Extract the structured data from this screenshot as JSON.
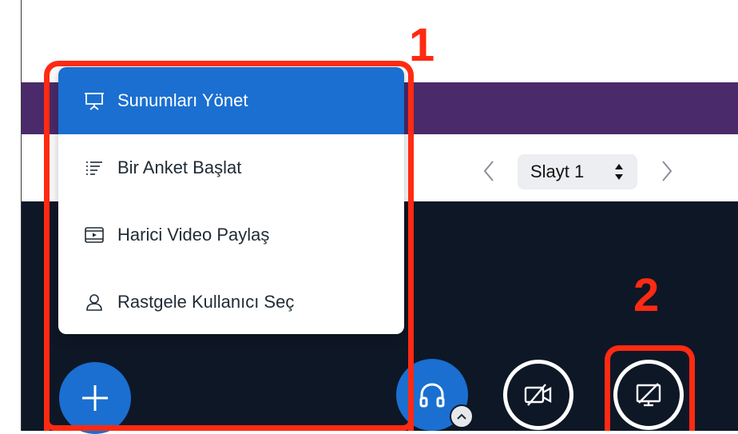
{
  "menu": {
    "items": [
      {
        "label": "Sunumları Yönet",
        "icon": "presentation-icon",
        "active": true
      },
      {
        "label": "Bir Anket Başlat",
        "icon": "poll-list-icon",
        "active": false
      },
      {
        "label": "Harici Video Paylaş",
        "icon": "video-film-icon",
        "active": false
      },
      {
        "label": "Rastgele Kullanıcı Seç",
        "icon": "user-icon",
        "active": false
      }
    ]
  },
  "slide_nav": {
    "current": "Slayt 1"
  },
  "annotations": {
    "one": "1",
    "two": "2"
  },
  "colors": {
    "accent": "#1a6fd1",
    "annotation": "#ff2a12",
    "header_purple": "#4a2a6a",
    "dark_bg": "#0e1726"
  }
}
